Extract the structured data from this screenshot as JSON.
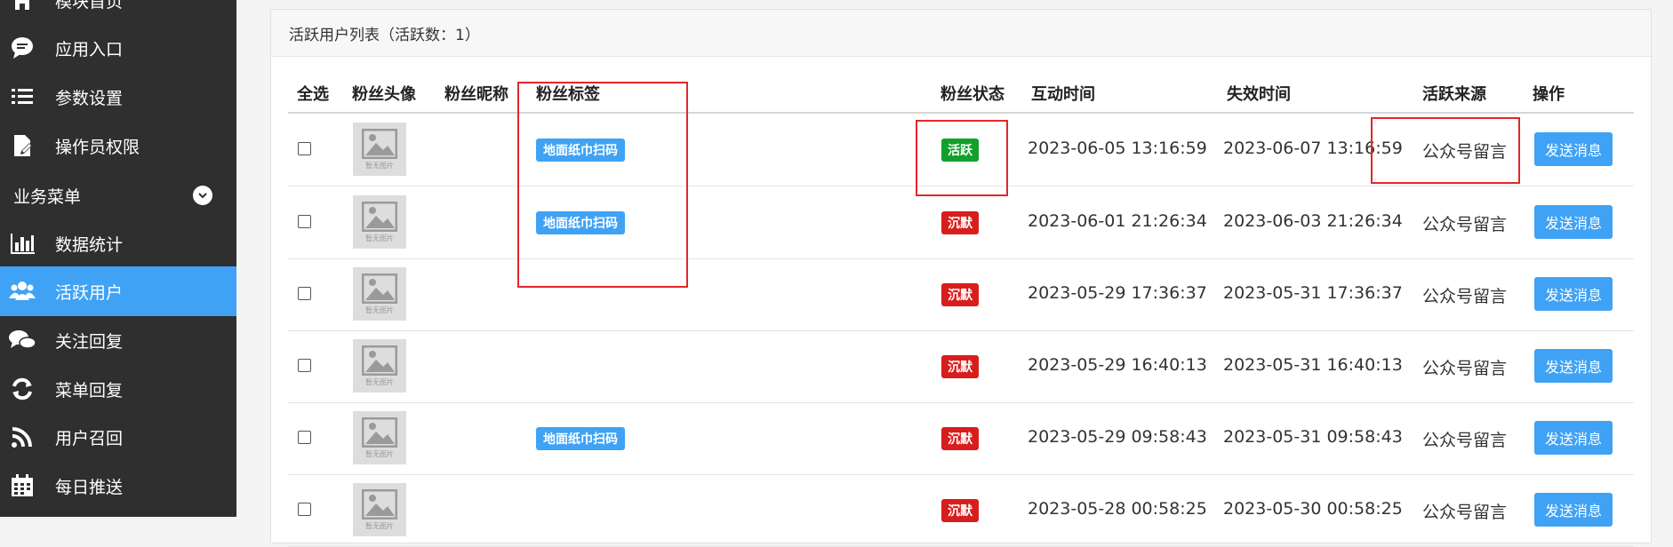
{
  "sidebar": {
    "items": [
      {
        "label": "模块首页",
        "icon": "home-icon"
      },
      {
        "label": "应用入口",
        "icon": "chat-bubble-icon"
      },
      {
        "label": "参数设置",
        "icon": "list-icon"
      },
      {
        "label": "操作员权限",
        "icon": "edit-document-icon"
      }
    ],
    "section": {
      "label": "业务菜单",
      "icon": "chevron-down-icon"
    },
    "section_items": [
      {
        "label": "数据统计",
        "icon": "bar-chart-icon"
      },
      {
        "label": "活跃用户",
        "icon": "users-icon",
        "active": true
      },
      {
        "label": "关注回复",
        "icon": "comments-icon"
      },
      {
        "label": "菜单回复",
        "icon": "refresh-icon"
      },
      {
        "label": "用户召回",
        "icon": "rss-icon"
      },
      {
        "label": "每日推送",
        "icon": "calendar-icon"
      }
    ]
  },
  "panel": {
    "title": "活跃用户列表（活跃数：1）"
  },
  "table": {
    "headers": {
      "select_all": "全选",
      "avatar": "粉丝头像",
      "nickname": "粉丝昵称",
      "tag": "粉丝标签",
      "status": "粉丝状态",
      "interact_time": "互动时间",
      "expire_time": "失效时间",
      "source": "活跃来源",
      "action": "操作"
    },
    "avatar_caption": "暂无图片",
    "rows": [
      {
        "tag": "地面纸巾扫码",
        "status": "活跃",
        "interact": "2023-06-05 13:16:59",
        "expire": "2023-06-07 13:16:59",
        "source": "公众号留言",
        "action": "发送消息"
      },
      {
        "tag": "地面纸巾扫码",
        "status": "沉默",
        "interact": "2023-06-01 21:26:34",
        "expire": "2023-06-03 21:26:34",
        "source": "公众号留言",
        "action": "发送消息"
      },
      {
        "tag": "",
        "status": "沉默",
        "interact": "2023-05-29 17:36:37",
        "expire": "2023-05-31 17:36:37",
        "source": "公众号留言",
        "action": "发送消息"
      },
      {
        "tag": "",
        "status": "沉默",
        "interact": "2023-05-29 16:40:13",
        "expire": "2023-05-31 16:40:13",
        "source": "公众号留言",
        "action": "发送消息"
      },
      {
        "tag": "地面纸巾扫码",
        "status": "沉默",
        "interact": "2023-05-29 09:58:43",
        "expire": "2023-05-31 09:58:43",
        "source": "公众号留言",
        "action": "发送消息"
      },
      {
        "tag": "",
        "status": "沉默",
        "interact": "2023-05-28 00:58:25",
        "expire": "2023-05-30 00:58:25",
        "source": "公众号留言",
        "action": "发送消息"
      }
    ]
  },
  "colors": {
    "sidebar_bg": "#2f2f2f",
    "accent": "#3fa2f5",
    "status_active": "#12a02a",
    "status_silent": "#d81d1d",
    "annotation_red": "#e3262b"
  }
}
